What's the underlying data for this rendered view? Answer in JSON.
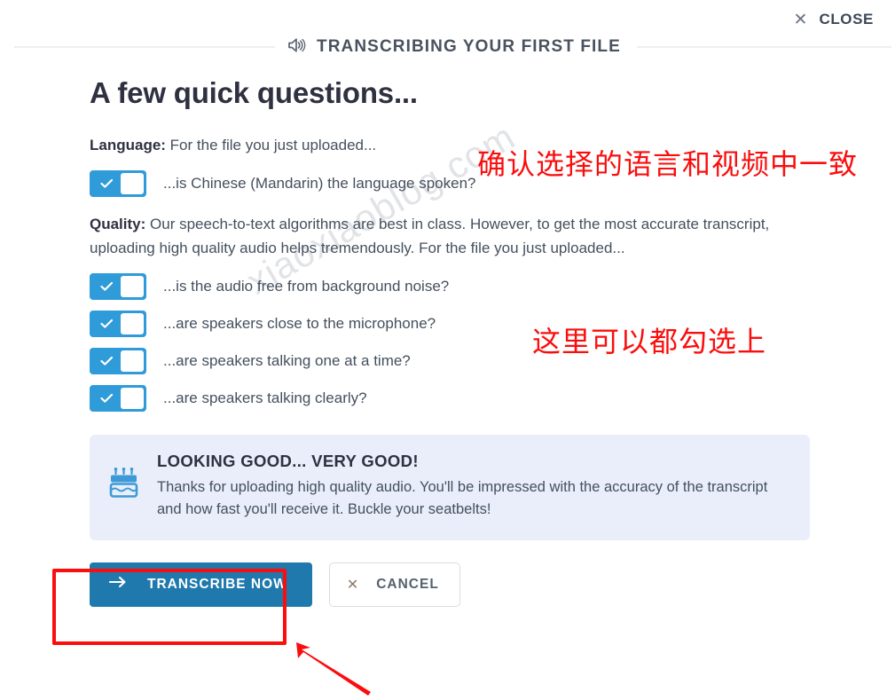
{
  "close": {
    "label": "CLOSE",
    "icon": "close-icon"
  },
  "header": {
    "title": "TRANSCRIBING YOUR FIRST FILE",
    "icon": "speaker-icon"
  },
  "main": {
    "page_title": "A few quick questions...",
    "language_section": {
      "label": "Language:",
      "text": " For the file you just uploaded...",
      "questions": [
        {
          "label": "...is Chinese (Mandarin) the language spoken?",
          "checked": true
        }
      ]
    },
    "quality_section": {
      "label": "Quality:",
      "text": " Our speech-to-text algorithms are best in class. However, to get the most accurate transcript, uploading high quality audio helps tremendously. For the file you just uploaded...",
      "questions": [
        {
          "label": "...is the audio free from background noise?",
          "checked": true
        },
        {
          "label": "...are speakers close to the microphone?",
          "checked": true
        },
        {
          "label": "...are speakers talking one at a time?",
          "checked": true
        },
        {
          "label": "...are speakers talking clearly?",
          "checked": true
        }
      ]
    },
    "callout": {
      "icon": "cake-icon",
      "title": "LOOKING GOOD... VERY GOOD!",
      "text": "Thanks for uploading high quality audio. You'll be impressed with the accuracy of the transcript and how fast you'll receive it. Buckle your seatbelts!"
    },
    "actions": {
      "primary": {
        "label": "TRANSCRIBE NOW",
        "icon": "arrow-right-icon"
      },
      "secondary": {
        "label": "CANCEL",
        "icon": "x-icon"
      }
    }
  },
  "annotations": {
    "language_note": "确认选择的语言和视频中一致",
    "checkboxes_note": "这里可以都勾选上"
  },
  "watermark": {
    "text": "xiaoxiaoblog.com"
  },
  "colors": {
    "primary_button": "#1f79ac",
    "toggle_on": "#2f9bd8",
    "callout_bg": "#e9eefa",
    "annotation": "#fb0d0d",
    "text": "#44505e"
  }
}
